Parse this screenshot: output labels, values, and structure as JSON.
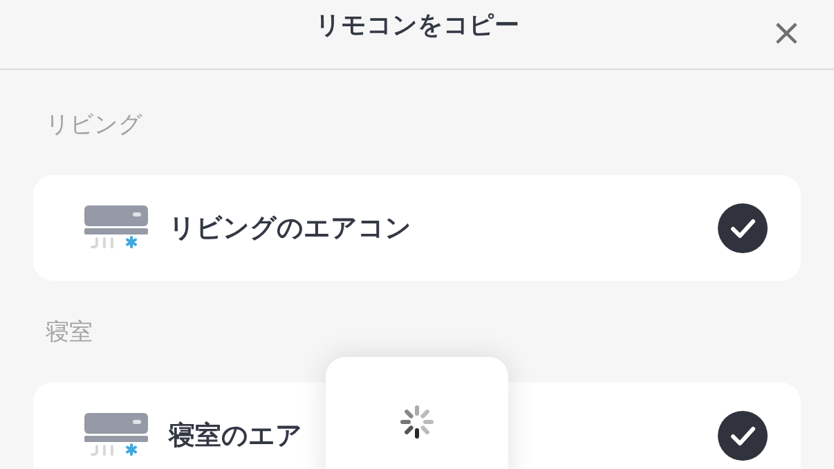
{
  "header": {
    "title": "リモコンをコピー",
    "close": "×"
  },
  "sections": [
    {
      "label": "リビング",
      "devices": [
        {
          "name": "リビングのエアコン",
          "selected": true
        }
      ]
    },
    {
      "label": "寝室",
      "devices": [
        {
          "name": "寝室のエア",
          "selected": true
        }
      ]
    }
  ],
  "overlay": {
    "kind": "spinner"
  }
}
